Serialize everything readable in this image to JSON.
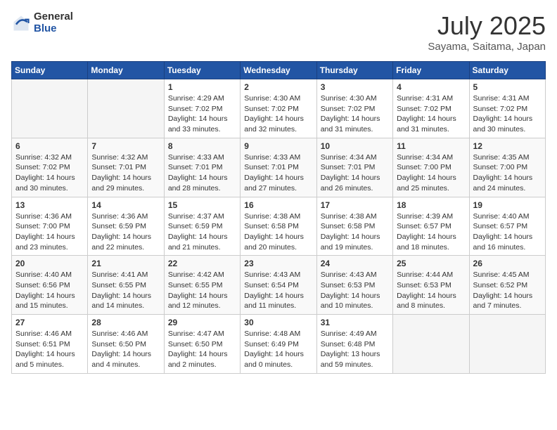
{
  "header": {
    "logo_general": "General",
    "logo_blue": "Blue",
    "month": "July 2025",
    "location": "Sayama, Saitama, Japan"
  },
  "days_of_week": [
    "Sunday",
    "Monday",
    "Tuesday",
    "Wednesday",
    "Thursday",
    "Friday",
    "Saturday"
  ],
  "weeks": [
    [
      {
        "day": "",
        "info": ""
      },
      {
        "day": "",
        "info": ""
      },
      {
        "day": "1",
        "info": "Sunrise: 4:29 AM\nSunset: 7:02 PM\nDaylight: 14 hours and 33 minutes."
      },
      {
        "day": "2",
        "info": "Sunrise: 4:30 AM\nSunset: 7:02 PM\nDaylight: 14 hours and 32 minutes."
      },
      {
        "day": "3",
        "info": "Sunrise: 4:30 AM\nSunset: 7:02 PM\nDaylight: 14 hours and 31 minutes."
      },
      {
        "day": "4",
        "info": "Sunrise: 4:31 AM\nSunset: 7:02 PM\nDaylight: 14 hours and 31 minutes."
      },
      {
        "day": "5",
        "info": "Sunrise: 4:31 AM\nSunset: 7:02 PM\nDaylight: 14 hours and 30 minutes."
      }
    ],
    [
      {
        "day": "6",
        "info": "Sunrise: 4:32 AM\nSunset: 7:02 PM\nDaylight: 14 hours and 30 minutes."
      },
      {
        "day": "7",
        "info": "Sunrise: 4:32 AM\nSunset: 7:01 PM\nDaylight: 14 hours and 29 minutes."
      },
      {
        "day": "8",
        "info": "Sunrise: 4:33 AM\nSunset: 7:01 PM\nDaylight: 14 hours and 28 minutes."
      },
      {
        "day": "9",
        "info": "Sunrise: 4:33 AM\nSunset: 7:01 PM\nDaylight: 14 hours and 27 minutes."
      },
      {
        "day": "10",
        "info": "Sunrise: 4:34 AM\nSunset: 7:01 PM\nDaylight: 14 hours and 26 minutes."
      },
      {
        "day": "11",
        "info": "Sunrise: 4:34 AM\nSunset: 7:00 PM\nDaylight: 14 hours and 25 minutes."
      },
      {
        "day": "12",
        "info": "Sunrise: 4:35 AM\nSunset: 7:00 PM\nDaylight: 14 hours and 24 minutes."
      }
    ],
    [
      {
        "day": "13",
        "info": "Sunrise: 4:36 AM\nSunset: 7:00 PM\nDaylight: 14 hours and 23 minutes."
      },
      {
        "day": "14",
        "info": "Sunrise: 4:36 AM\nSunset: 6:59 PM\nDaylight: 14 hours and 22 minutes."
      },
      {
        "day": "15",
        "info": "Sunrise: 4:37 AM\nSunset: 6:59 PM\nDaylight: 14 hours and 21 minutes."
      },
      {
        "day": "16",
        "info": "Sunrise: 4:38 AM\nSunset: 6:58 PM\nDaylight: 14 hours and 20 minutes."
      },
      {
        "day": "17",
        "info": "Sunrise: 4:38 AM\nSunset: 6:58 PM\nDaylight: 14 hours and 19 minutes."
      },
      {
        "day": "18",
        "info": "Sunrise: 4:39 AM\nSunset: 6:57 PM\nDaylight: 14 hours and 18 minutes."
      },
      {
        "day": "19",
        "info": "Sunrise: 4:40 AM\nSunset: 6:57 PM\nDaylight: 14 hours and 16 minutes."
      }
    ],
    [
      {
        "day": "20",
        "info": "Sunrise: 4:40 AM\nSunset: 6:56 PM\nDaylight: 14 hours and 15 minutes."
      },
      {
        "day": "21",
        "info": "Sunrise: 4:41 AM\nSunset: 6:55 PM\nDaylight: 14 hours and 14 minutes."
      },
      {
        "day": "22",
        "info": "Sunrise: 4:42 AM\nSunset: 6:55 PM\nDaylight: 14 hours and 12 minutes."
      },
      {
        "day": "23",
        "info": "Sunrise: 4:43 AM\nSunset: 6:54 PM\nDaylight: 14 hours and 11 minutes."
      },
      {
        "day": "24",
        "info": "Sunrise: 4:43 AM\nSunset: 6:53 PM\nDaylight: 14 hours and 10 minutes."
      },
      {
        "day": "25",
        "info": "Sunrise: 4:44 AM\nSunset: 6:53 PM\nDaylight: 14 hours and 8 minutes."
      },
      {
        "day": "26",
        "info": "Sunrise: 4:45 AM\nSunset: 6:52 PM\nDaylight: 14 hours and 7 minutes."
      }
    ],
    [
      {
        "day": "27",
        "info": "Sunrise: 4:46 AM\nSunset: 6:51 PM\nDaylight: 14 hours and 5 minutes."
      },
      {
        "day": "28",
        "info": "Sunrise: 4:46 AM\nSunset: 6:50 PM\nDaylight: 14 hours and 4 minutes."
      },
      {
        "day": "29",
        "info": "Sunrise: 4:47 AM\nSunset: 6:50 PM\nDaylight: 14 hours and 2 minutes."
      },
      {
        "day": "30",
        "info": "Sunrise: 4:48 AM\nSunset: 6:49 PM\nDaylight: 14 hours and 0 minutes."
      },
      {
        "day": "31",
        "info": "Sunrise: 4:49 AM\nSunset: 6:48 PM\nDaylight: 13 hours and 59 minutes."
      },
      {
        "day": "",
        "info": ""
      },
      {
        "day": "",
        "info": ""
      }
    ]
  ]
}
